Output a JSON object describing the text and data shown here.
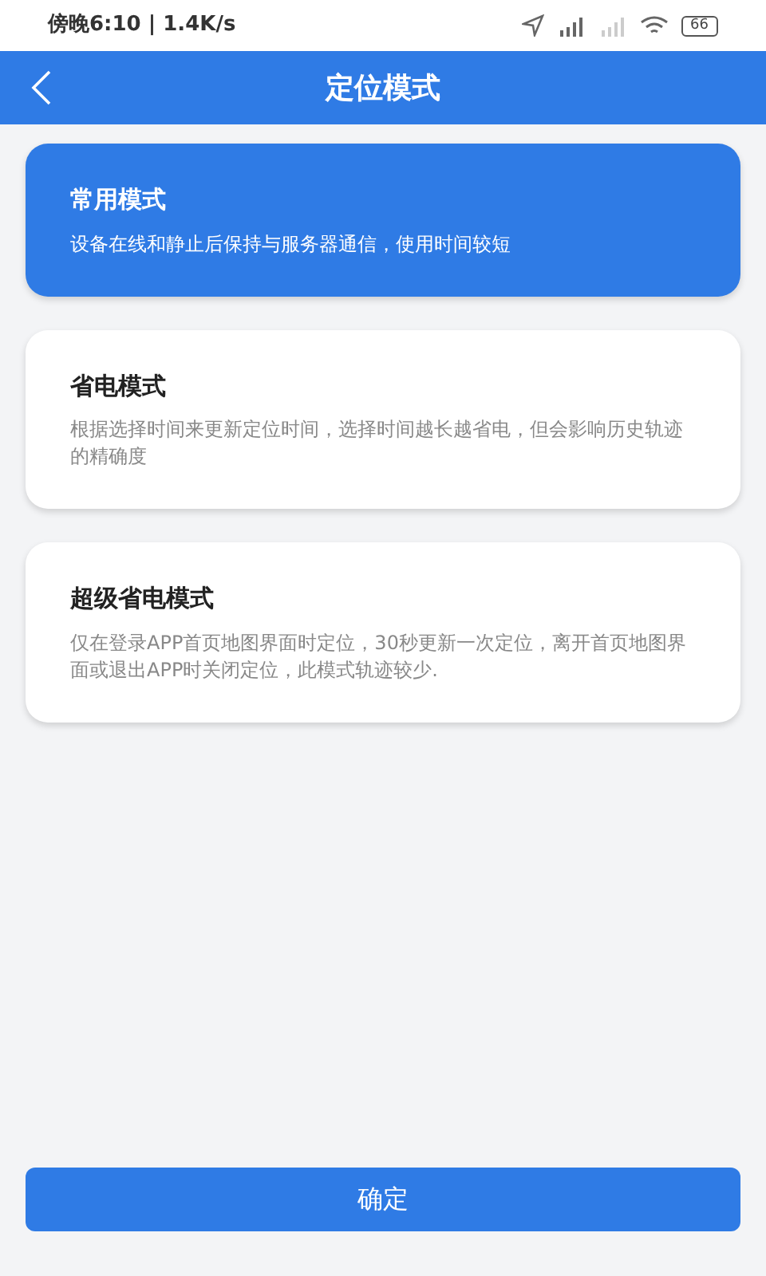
{
  "status_bar": {
    "time": "傍晚6:10 | 1.4K/s",
    "battery": "66"
  },
  "header": {
    "title": "定位模式"
  },
  "modes": [
    {
      "title": "常用模式",
      "description": "设备在线和静止后保持与服务器通信，使用时间较短",
      "selected": true
    },
    {
      "title": "省电模式",
      "description": "根据选择时间来更新定位时间，选择时间越长越省电，但会影响历史轨迹的精确度",
      "selected": false
    },
    {
      "title": "超级省电模式",
      "description": "仅在登录APP首页地图界面时定位，30秒更新一次定位，离开首页地图界面或退出APP时关闭定位，此模式轨迹较少.",
      "selected": false
    }
  ],
  "confirm_button": "确定"
}
